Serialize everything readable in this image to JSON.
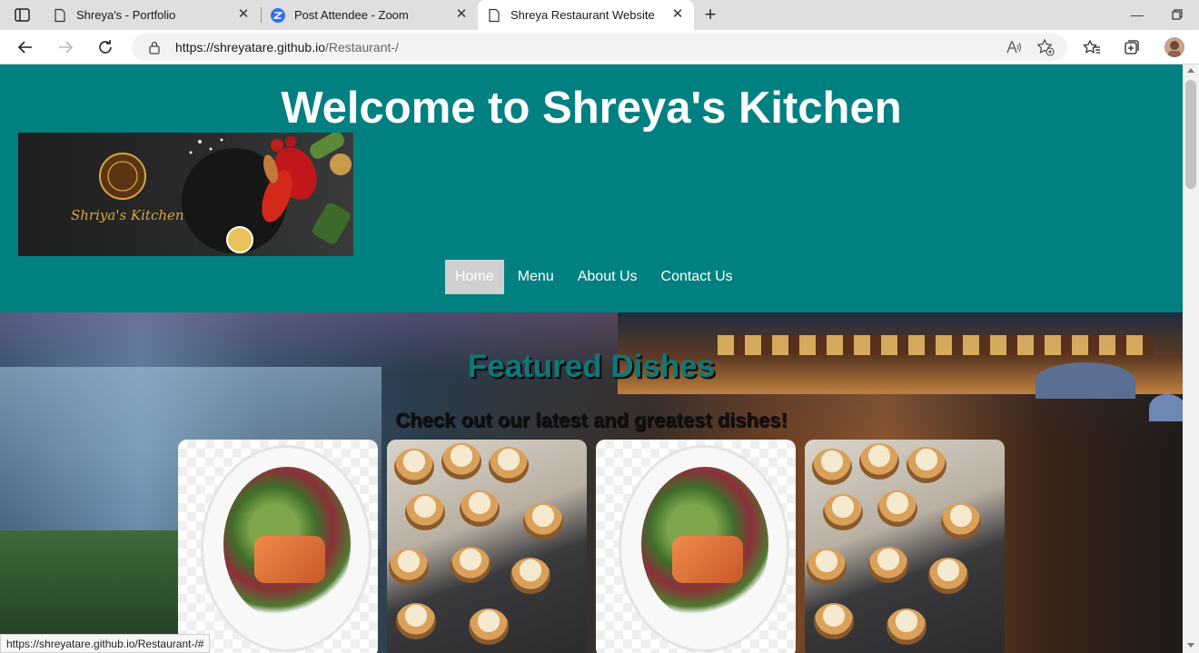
{
  "browser": {
    "tabs": [
      {
        "title": "Shreya's - Portfolio",
        "icon": "page-icon"
      },
      {
        "title": "Post Attendee - Zoom",
        "icon": "zoom-icon"
      },
      {
        "title": "Shreya Restaurant Website",
        "icon": "page-icon",
        "active": true
      }
    ],
    "address": {
      "host": "https://shreyatare.github.io",
      "path": "/Restaurant-/"
    },
    "status_url": "https://shreyatare.github.io/Restaurant-/#"
  },
  "site": {
    "title": "Welcome to Shreya's Kitchen",
    "logo_text": "Shriya's Kitchen",
    "nav": [
      {
        "label": "Home",
        "active": true
      },
      {
        "label": "Menu"
      },
      {
        "label": "About Us"
      },
      {
        "label": "Contact Us"
      }
    ],
    "featured": {
      "title": "Featured Dishes",
      "subtitle": "Check out our latest and greatest dishes!"
    }
  },
  "colors": {
    "header_bg": "#008080",
    "featured_title": "#0a7a7a",
    "nav_active_bg": "#d0d0d0"
  }
}
